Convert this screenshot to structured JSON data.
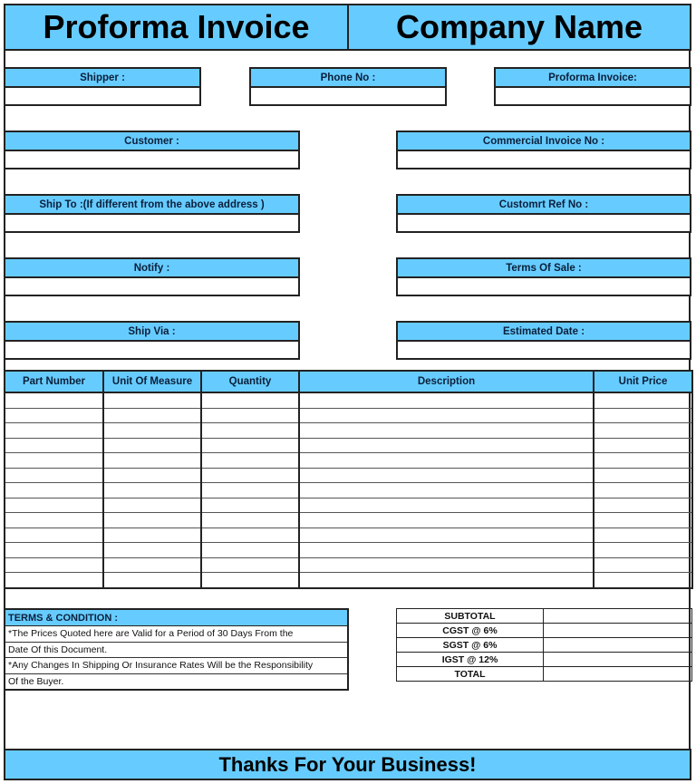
{
  "header": {
    "title": "Proforma Invoice",
    "company": "Company Name"
  },
  "fields": {
    "shipper": "Shipper :",
    "phone": "Phone No :",
    "proforma_invoice": "Proforma Invoice:",
    "customer": "Customer :",
    "commercial_invoice": "Commercial Invoice No :",
    "ship_to": "Ship To :(If different from the above address )",
    "customer_ref": "Customrt Ref No :",
    "notify": "Notify :",
    "terms_of_sale": "Terms Of Sale :",
    "ship_via": "Ship Via :",
    "estimated_date": "Estimated Date :"
  },
  "items_table": {
    "columns": [
      "Part Number",
      "Unit Of Measure",
      "Quantity",
      "Description",
      "Unit Price"
    ],
    "row_count": 13,
    "rows": []
  },
  "terms": {
    "heading": "TERMS & CONDITION :",
    "lines": [
      "*The Prices Quoted here are Valid for a Period of 30 Days From the",
      "Date Of this Document.",
      "*Any Changes In Shipping Or Insurance Rates Will be the Responsibility",
      "Of the Buyer."
    ]
  },
  "totals": [
    {
      "label": "SUBTOTAL",
      "value": ""
    },
    {
      "label": "CGST @ 6%",
      "value": ""
    },
    {
      "label": "SGST @ 6%",
      "value": ""
    },
    {
      "label": "IGST @ 12%",
      "value": ""
    },
    {
      "label": "TOTAL",
      "value": ""
    }
  ],
  "footer": {
    "message": "Thanks For Your Business!"
  },
  "colors": {
    "accent": "#66ccff",
    "border": "#222222"
  }
}
